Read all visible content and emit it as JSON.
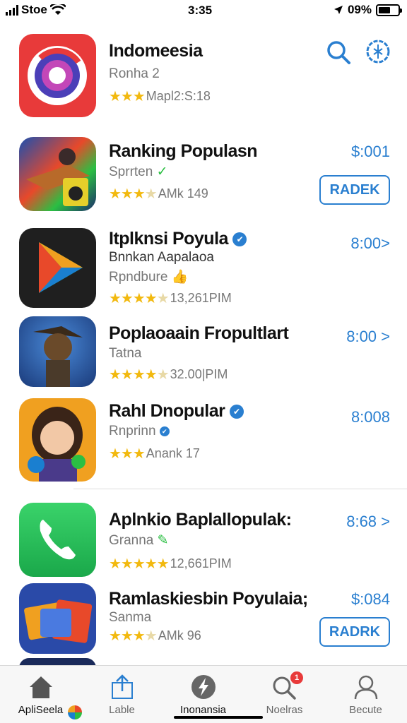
{
  "status_bar": {
    "carrier": "Stoe",
    "time": "3:35",
    "battery": "09%"
  },
  "header_app": {
    "title": "Indomeesia",
    "subtitle": "Ronha 2",
    "rating_text": "Mapl2:S:18",
    "stars": 3
  },
  "apps": [
    {
      "title": "Ranking Populasn",
      "subtitle": "Sprrten",
      "rating_text": "AMk 149",
      "stars": 3.5,
      "price": "$:001",
      "button": "RADEK"
    },
    {
      "title": "Itplknsi Poyula",
      "subtitle": "Bnnkan Aapalaoa",
      "subtitle2": "Rpndbure",
      "rating_text": "13,261PIM",
      "stars": 4.5,
      "price": "8:00>"
    },
    {
      "title": "Poplaoaain Fropultlart",
      "subtitle": "Tatna",
      "rating_text": "32.00|PIM",
      "stars": 4.5,
      "price": "8:00 >"
    },
    {
      "title": "Rahl Dnopular",
      "subtitle": "Rnprinn",
      "rating_text": "Anank 17",
      "stars": 3,
      "price": "8:008"
    },
    {
      "title": "Aplnkio Baplallopulak:",
      "subtitle": "Granna",
      "rating_text": "12,661PIM",
      "stars": 5,
      "price": "8:68 >"
    },
    {
      "title": "Ramlaskiesbin Poyulaia;",
      "subtitle": "Sanma",
      "rating_text": "AMk 96",
      "stars": 3.5,
      "price": "$:084",
      "button": "RADRK"
    }
  ],
  "tabs": [
    {
      "label": "ApliSeela",
      "icon": "home-icon"
    },
    {
      "label": "Lable",
      "icon": "upload-icon"
    },
    {
      "label": "Inonansia",
      "icon": "lightning-icon"
    },
    {
      "label": "Noelras",
      "icon": "search-notification-icon",
      "badge": "1"
    },
    {
      "label": "Becute",
      "icon": "person-icon"
    }
  ],
  "colors": {
    "accent": "#2a7fd0",
    "star": "#f2b90f"
  }
}
